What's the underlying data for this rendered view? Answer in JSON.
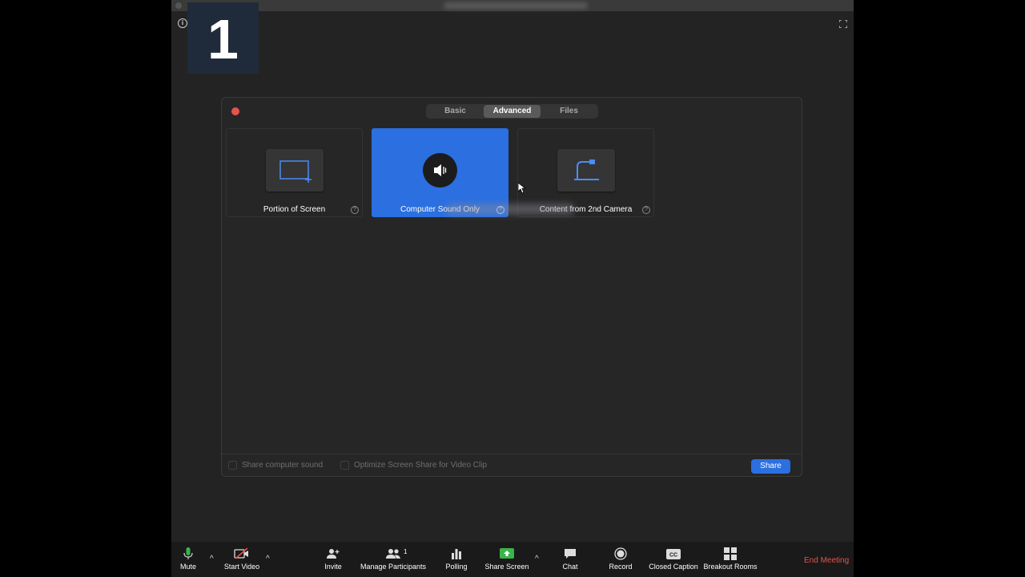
{
  "step_badge": "1",
  "tabs": [
    {
      "label": "Basic"
    },
    {
      "label": "Advanced"
    },
    {
      "label": "Files"
    }
  ],
  "options": [
    {
      "label": "Portion of Screen",
      "icon": "portion-screen-icon"
    },
    {
      "label": "Computer Sound Only",
      "icon": "speaker-icon"
    },
    {
      "label": "Content from 2nd Camera",
      "icon": "document-camera-icon"
    }
  ],
  "footer": {
    "share_sound": "Share computer sound",
    "optimize": "Optimize Screen Share for Video Clip",
    "share_button": "Share"
  },
  "toolbar": {
    "mute": "Mute",
    "start_video": "Start Video",
    "invite": "Invite",
    "manage_participants": "Manage Participants",
    "participant_count": "1",
    "polling": "Polling",
    "share_screen": "Share Screen",
    "chat": "Chat",
    "record": "Record",
    "closed_caption": "Closed Caption",
    "breakout_rooms": "Breakout Rooms",
    "end_meeting": "End Meeting"
  },
  "colors": {
    "accent": "#2b6fe0",
    "end_meeting": "#e5534b",
    "share_green": "#39b54a"
  }
}
